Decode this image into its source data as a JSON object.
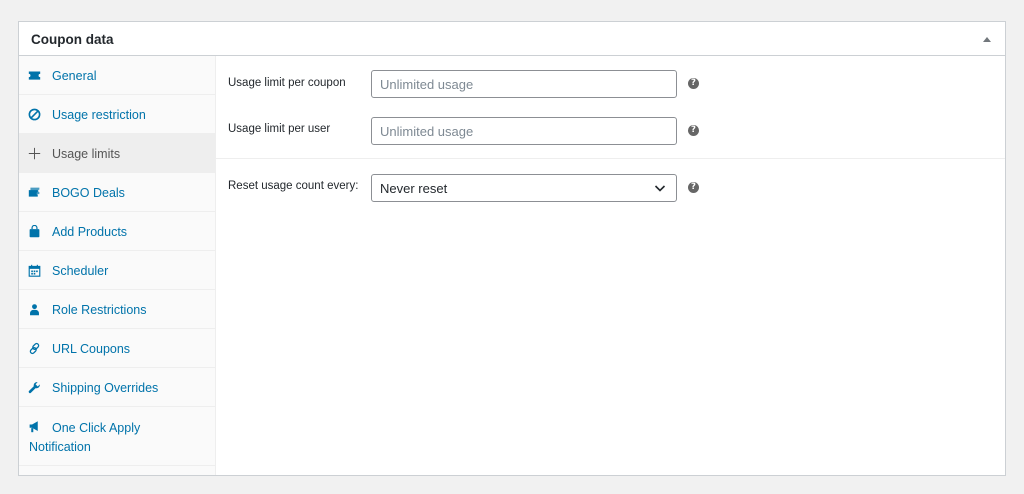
{
  "panel": {
    "title": "Coupon data"
  },
  "tabs": [
    {
      "label": "General",
      "icon": "ticket-icon",
      "active": false
    },
    {
      "label": "Usage restriction",
      "icon": "block-icon",
      "active": false
    },
    {
      "label": "Usage limits",
      "icon": "plus-icon",
      "active": true
    },
    {
      "label": "BOGO Deals",
      "icon": "tickets-icon",
      "active": false
    },
    {
      "label": "Add Products",
      "icon": "bag-icon",
      "active": false
    },
    {
      "label": "Scheduler",
      "icon": "calendar-icon",
      "active": false
    },
    {
      "label": "Role Restrictions",
      "icon": "user-icon",
      "active": false
    },
    {
      "label": "URL Coupons",
      "icon": "link-icon",
      "active": false
    },
    {
      "label": "Shipping Overrides",
      "icon": "wrench-icon",
      "active": false
    },
    {
      "label": "One Click Apply Notification",
      "icon": "megaphone-icon",
      "active": false
    }
  ],
  "fields": {
    "usage_limit_per_coupon": {
      "label": "Usage limit per coupon",
      "placeholder": "Unlimited usage",
      "value": ""
    },
    "usage_limit_per_user": {
      "label": "Usage limit per user",
      "placeholder": "Unlimited usage",
      "value": ""
    },
    "reset_usage_count": {
      "label": "Reset usage count every:",
      "selected": "Never reset"
    }
  },
  "colors": {
    "link": "#0073aa",
    "active_text": "#555555",
    "border": "#ccd0d4"
  }
}
